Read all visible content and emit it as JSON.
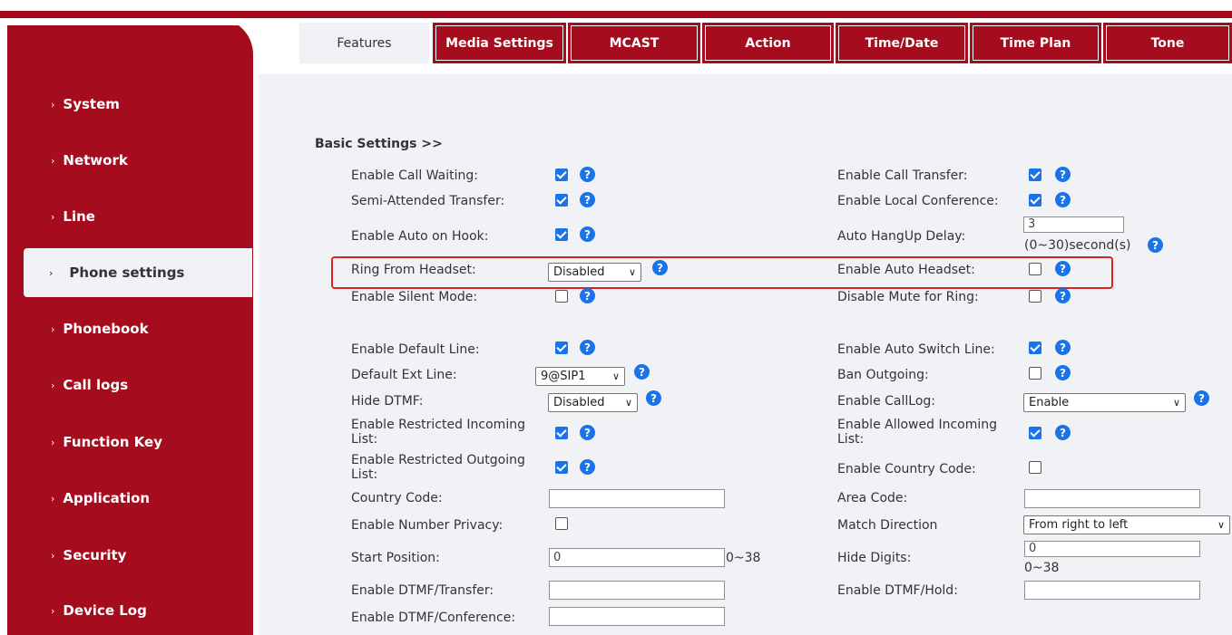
{
  "sidebar": {
    "items": [
      {
        "label": "System"
      },
      {
        "label": "Network"
      },
      {
        "label": "Line"
      },
      {
        "label": "Phone settings"
      },
      {
        "label": "Phonebook"
      },
      {
        "label": "Call logs"
      },
      {
        "label": "Function Key"
      },
      {
        "label": "Application"
      },
      {
        "label": "Security"
      },
      {
        "label": "Device Log"
      }
    ],
    "active": "Phone settings",
    "arrow": "›"
  },
  "tabs": [
    "Features",
    "Media Settings",
    "MCAST",
    "Action",
    "Time/Date",
    "Time Plan",
    "Tone"
  ],
  "active_tab": "Features",
  "section_title": "Basic Settings >>",
  "help_glyph": "?",
  "chevron": "∨",
  "left_fields": {
    "call_waiting": {
      "label": "Enable Call Waiting:",
      "checked": true
    },
    "semi_attended": {
      "label": "Semi-Attended Transfer:",
      "checked": true
    },
    "auto_on_hook": {
      "label": "Enable Auto on Hook:",
      "checked": true
    },
    "ring_from_headset": {
      "label": "Ring From Headset:",
      "value": "Disabled"
    },
    "silent_mode": {
      "label": "Enable Silent Mode:",
      "checked": false
    },
    "default_line": {
      "label": "Enable Default Line:",
      "checked": true
    },
    "default_ext_line": {
      "label": "Default Ext Line:",
      "value": "9@SIP1"
    },
    "hide_dtmf": {
      "label": "Hide DTMF:",
      "value": "Disabled"
    },
    "restricted_incoming": {
      "label_1": "Enable Restricted Incoming",
      "label_2": "List:",
      "checked": true
    },
    "restricted_outgoing": {
      "label_1": "Enable Restricted Outgoing",
      "label_2": "List:",
      "checked": true
    },
    "country_code": {
      "label": "Country Code:",
      "value": ""
    },
    "number_privacy": {
      "label": "Enable Number Privacy:",
      "checked": false
    },
    "start_position": {
      "label": "Start Position:",
      "value": "0",
      "range": "0~38"
    },
    "dtmf_transfer": {
      "label": "Enable DTMF/Transfer:",
      "value": ""
    },
    "dtmf_conference": {
      "label": "Enable DTMF/Conference:",
      "value": ""
    }
  },
  "right_fields": {
    "call_transfer": {
      "label": "Enable Call Transfer:",
      "checked": true
    },
    "local_conference": {
      "label": "Enable Local Conference:",
      "checked": true
    },
    "auto_hangup_delay": {
      "label": "Auto HangUp Delay:",
      "value": "3",
      "range": "(0~30)second(s)"
    },
    "auto_headset": {
      "label": "Enable Auto Headset:",
      "checked": false
    },
    "disable_mute_ring": {
      "label": "Disable Mute for Ring:",
      "checked": false
    },
    "auto_switch_line": {
      "label": "Enable Auto Switch Line:",
      "checked": true
    },
    "ban_outgoing": {
      "label": "Ban Outgoing:",
      "checked": false
    },
    "calllog": {
      "label": "Enable CallLog:",
      "value": "Enable"
    },
    "allowed_incoming": {
      "label_1": "Enable Allowed Incoming",
      "label_2": "List:",
      "checked": true
    },
    "country_code_enable": {
      "label": "Enable Country Code:",
      "checked": false
    },
    "area_code": {
      "label": "Area Code:",
      "value": ""
    },
    "match_direction": {
      "label": "Match Direction",
      "value": "From right to left"
    },
    "hide_digits": {
      "label": "Hide Digits:",
      "value": "0",
      "range": "0~38"
    },
    "dtmf_hold": {
      "label": "Enable DTMF/Hold:",
      "value": ""
    }
  }
}
